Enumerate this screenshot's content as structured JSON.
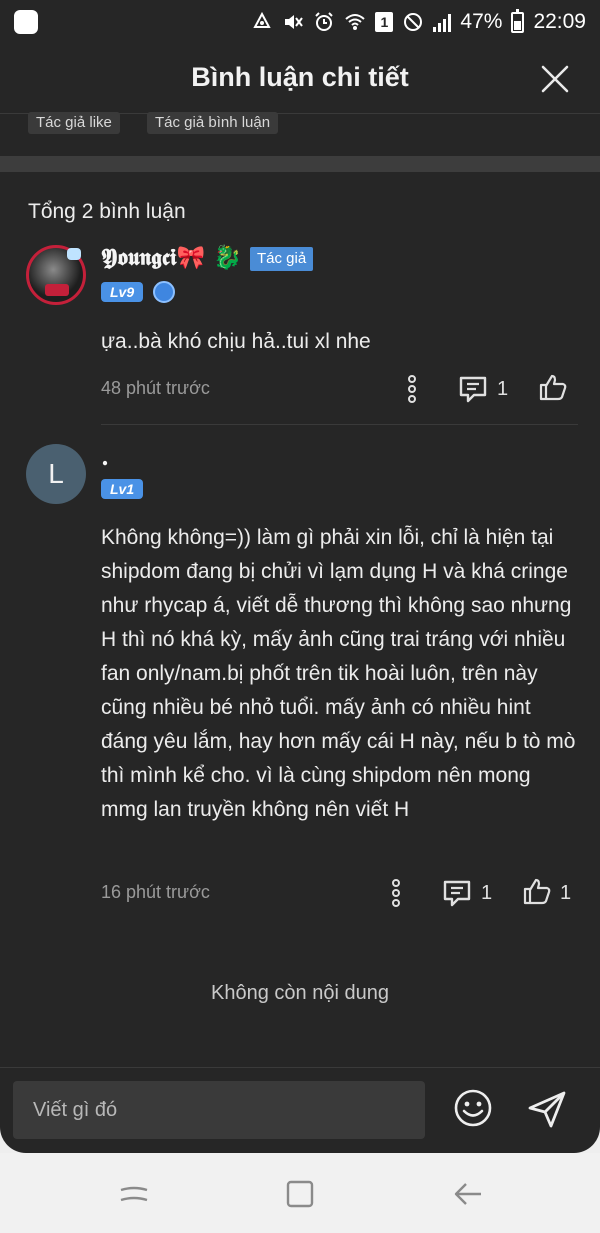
{
  "status_bar": {
    "time": "22:09",
    "battery": "47%",
    "notification_count": "1",
    "icons": [
      "app-square-icon",
      "recycle-icon",
      "mute-icon",
      "alarm-icon",
      "wifi-icon",
      "sim-badge-icon",
      "do-not-disturb-icon",
      "signal-icon",
      "battery-icon"
    ]
  },
  "header": {
    "title": "Bình luận chi tiết",
    "close_icon": "close-icon"
  },
  "chips": [
    "Tác giả like",
    "Tác giả bình luận"
  ],
  "comments_section": {
    "total": "Tổng 2 bình luận",
    "comments": [
      {
        "username": "𝖄𝖔𝖚𝖓𝖌𝖈𝖎🎀 🐉",
        "author_tag": "Tác giả",
        "level": "Lv9",
        "text": "ựa..bà khó chịu hả..tui xl nhe",
        "time": "48 phút trước",
        "reply_count": "1",
        "like_count": ""
      },
      {
        "username": ".",
        "avatar_letter": "L",
        "level": "Lv1",
        "text": "Không không=)) làm gì phải xin lỗi, chỉ là hiện tại shipdom đang bị chửi vì lạm dụng H và khá cringe như rhycap á, viết dễ thương thì không sao nhưng H thì nó khá kỳ, mấy ảnh cũng trai tráng với nhiều fan only/nam.bị phốt trên tik hoài luôn, trên này cũng nhiều bé nhỏ tuổi. mấy ảnh có nhiều hint đáng yêu lắm, hay hơn mấy cái H này, nếu b tò mò thì mình kể cho. vì là cùng shipdom nên mong mmg lan truyền không nên viết H",
        "time": "16 phút trước",
        "reply_count": "1",
        "like_count": "1"
      }
    ],
    "end_text": "Không còn nội dung"
  },
  "composer": {
    "placeholder": "Viết gì đó",
    "emoji_icon": "smiley-icon",
    "send_icon": "send-icon"
  },
  "nav_bar": {
    "icons": [
      "recent-apps-icon",
      "home-icon",
      "back-icon"
    ]
  },
  "colors": {
    "background": "#262626",
    "accent_blue": "#4a8cd6",
    "avatar_ring": "#c4203a"
  }
}
